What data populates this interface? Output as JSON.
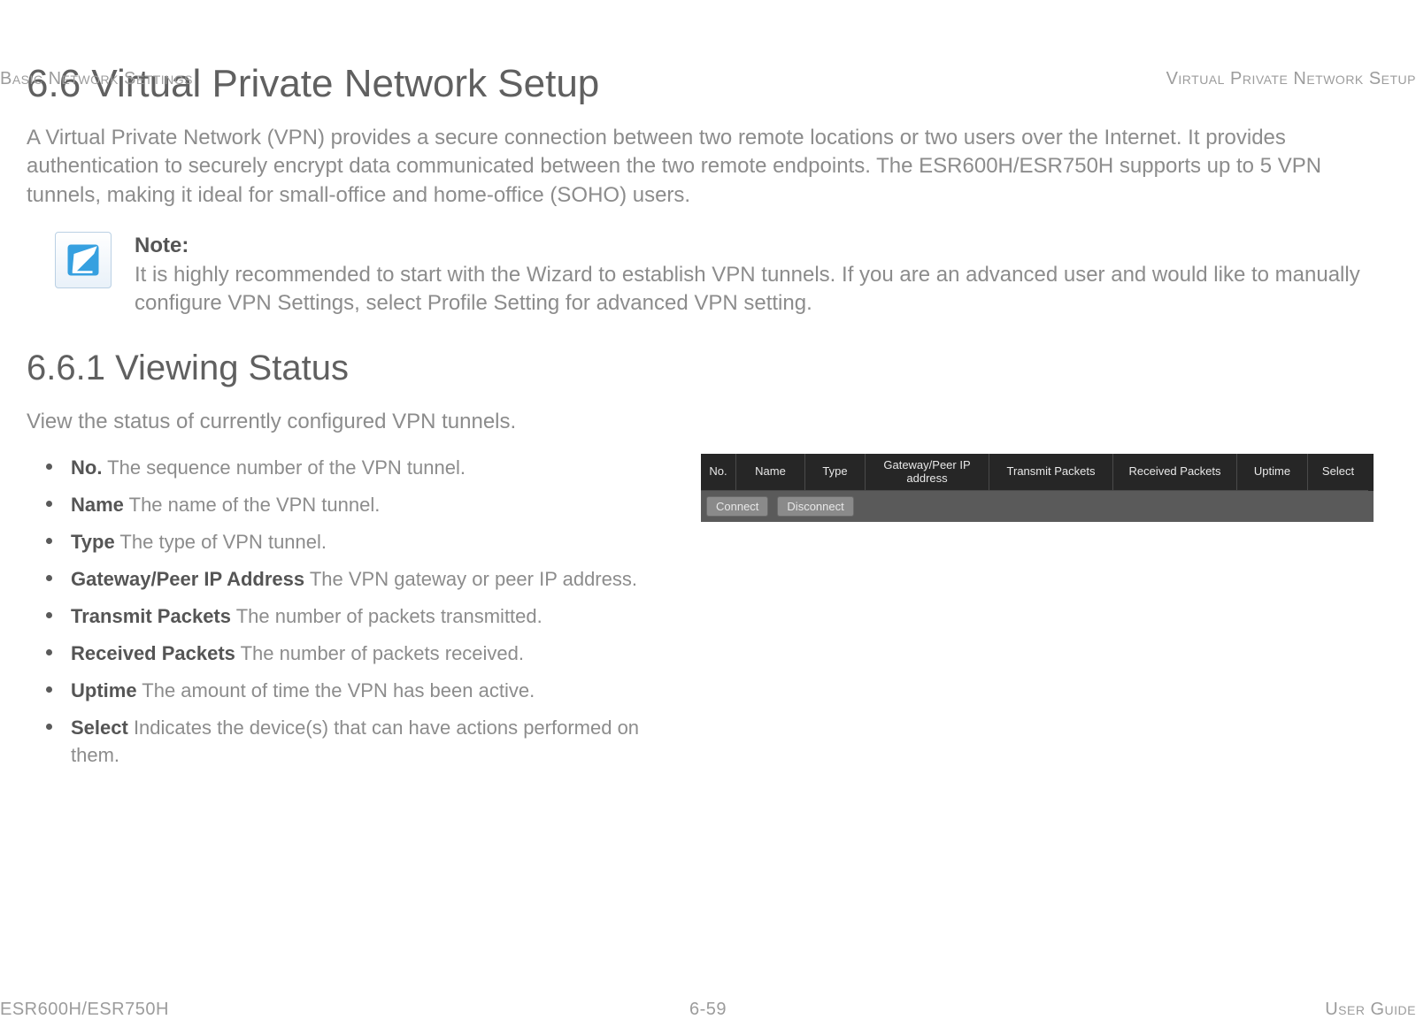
{
  "header": {
    "left": "Basic Network Settings",
    "right": "Virtual Private Network Setup"
  },
  "footer": {
    "left": "ESR600H/ESR750H",
    "center": "6-59",
    "right": "User Guide"
  },
  "section": {
    "title": "6.6 Virtual Private Network Setup",
    "intro": "A Virtual Private Network (VPN) provides a secure connection between two remote locations or two users over the Internet. It provides authentication to securely encrypt data communicated between the two remote endpoints. The ESR600H/ESR750H supports up to 5 VPN tunnels, making it ideal for small-office and home-office (SOHO) users."
  },
  "note": {
    "label": "Note:",
    "body": "It is highly recommended to start with the Wizard to establish VPN tunnels. If you are an advanced user and would like to manually configure VPN Settings, select Profile Setting for advanced VPN setting."
  },
  "subsection": {
    "title": "6.6.1 Viewing Status",
    "intro": "View the status of currently configured VPN tunnels."
  },
  "bullets": [
    {
      "term": "No.",
      "desc": "  The sequence number of the VPN tunnel."
    },
    {
      "term": "Name",
      "desc": "  The name of the VPN tunnel."
    },
    {
      "term": "Type",
      "desc": "  The type of VPN tunnel."
    },
    {
      "term": "Gateway/Peer IP Address",
      "desc": "  The VPN gateway or peer IP address."
    },
    {
      "term": "Transmit Packets",
      "desc": "  The number of packets transmitted."
    },
    {
      "term": "Received Packets",
      "desc": "  The number of packets received."
    },
    {
      "term": "Uptime",
      "desc": "  The amount of time the VPN has been active."
    },
    {
      "term": "Select",
      "desc": "  Indicates the device(s) that can have actions performed on them."
    }
  ],
  "vpn_table": {
    "columns": [
      "No.",
      "Name",
      "Type",
      "Gateway/Peer IP address",
      "Transmit Packets",
      "Received Packets",
      "Uptime",
      "Select"
    ],
    "actions": {
      "connect": "Connect",
      "disconnect": "Disconnect"
    }
  }
}
